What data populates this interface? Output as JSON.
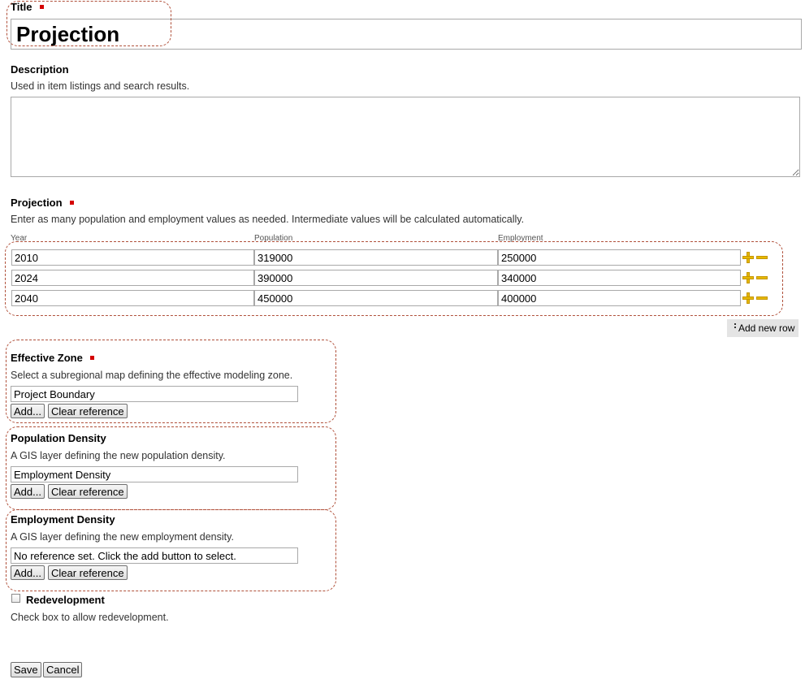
{
  "title": {
    "label": "Title",
    "value": "Projection"
  },
  "description": {
    "label": "Description",
    "help": "Used in item listings and search results.",
    "value": ""
  },
  "projection": {
    "label": "Projection",
    "help": "Enter as many population and employment values as needed. Intermediate values will be calculated automatically.",
    "columns": [
      "Year",
      "Population",
      "Employment"
    ],
    "rows": [
      {
        "year": "2010",
        "population": "319000",
        "employment": "250000"
      },
      {
        "year": "2024",
        "population": "390000",
        "employment": "340000"
      },
      {
        "year": "2040",
        "population": "450000",
        "employment": "400000"
      }
    ],
    "add_row_label": "Add new row"
  },
  "effective_zone": {
    "label": "Effective Zone",
    "help": "Select a subregional map defining the effective modeling zone.",
    "value": "Project Boundary",
    "add_label": "Add...",
    "clear_label": "Clear reference"
  },
  "population_density": {
    "label": "Population Density",
    "help": "A GIS layer defining the new population density.",
    "value": "Employment Density",
    "add_label": "Add...",
    "clear_label": "Clear reference"
  },
  "employment_density": {
    "label": "Employment Density",
    "help": "A GIS layer defining the new employment density.",
    "value": "No reference set. Click the add button to select.",
    "add_label": "Add...",
    "clear_label": "Clear reference"
  },
  "redevelopment": {
    "label": "Redevelopment",
    "help": "Check box to allow redevelopment.",
    "checked": false
  },
  "actions": {
    "save_label": "Save",
    "cancel_label": "Cancel"
  },
  "colors": {
    "required_marker": "#d40000",
    "annotation_outline": "#b0503a",
    "row_icon": "#e6b800"
  },
  "icons": [
    "add-row-plus-icon",
    "remove-row-minus-icon",
    "drag-dots-icon",
    "required-marker-icon"
  ]
}
